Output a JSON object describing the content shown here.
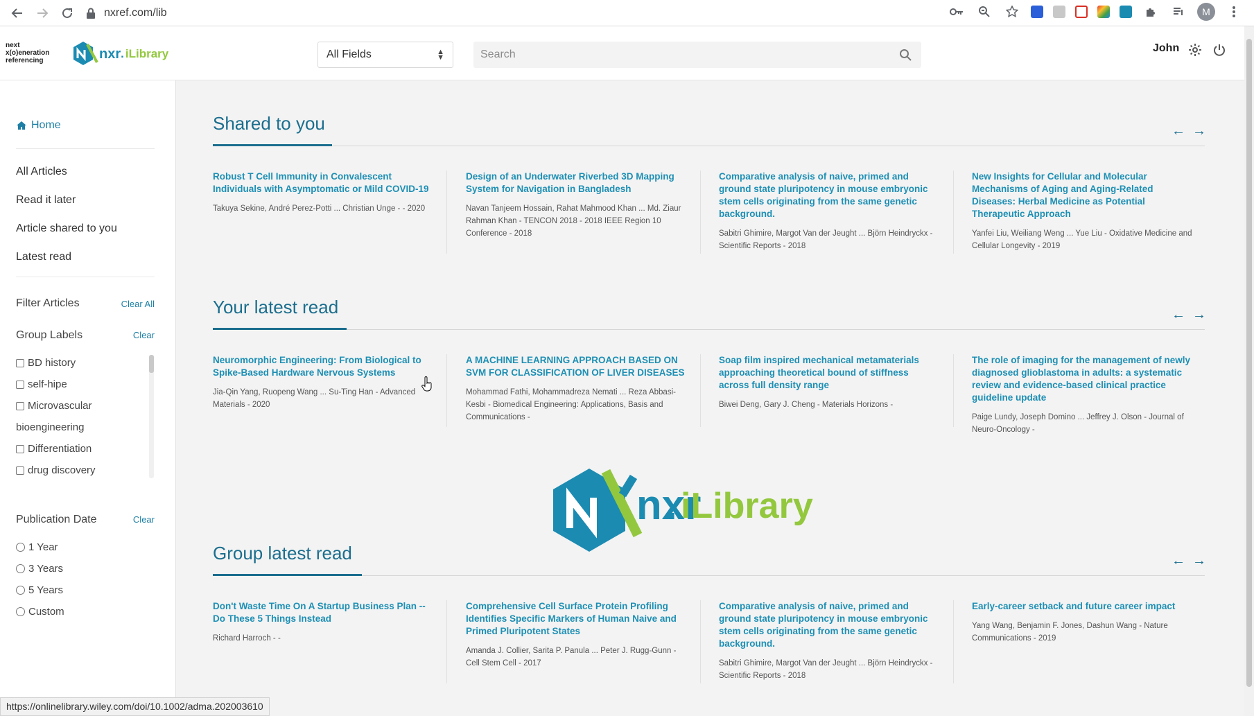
{
  "browser": {
    "url": "nxref.com/lib",
    "avatar_letter": "M",
    "status_url": "https://onlinelibrary.wiley.com/doi/10.1002/adma.202003610"
  },
  "header": {
    "brand_line1": "next",
    "brand_line2": "x(o)eneration",
    "brand_line3": "referencing",
    "logo_main": "nxr",
    "logo_dot": ".",
    "logo_sub": "iLibrary",
    "field_select": "All Fields",
    "search_placeholder": "Search",
    "user_name": "John"
  },
  "sidebar": {
    "home": "Home",
    "links": [
      "All Articles",
      "Read it later",
      "Article shared to you",
      "Latest read"
    ],
    "filter_title": "Filter Articles",
    "clear_all": "Clear All",
    "group_labels_title": "Group Labels",
    "group_labels_clear": "Clear",
    "group_labels": [
      "BD history",
      "self-hipe",
      "Microvascular",
      "bioengineering",
      "Differentiation",
      "drug discovery"
    ],
    "pub_date_title": "Publication Date",
    "pub_date_clear": "Clear",
    "pub_dates": [
      "1 Year",
      "3 Years",
      "5 Years",
      "Custom"
    ]
  },
  "sections": [
    {
      "title": "Shared to you",
      "cards": [
        {
          "title": "Robust T Cell Immunity in Convalescent Individuals with Asymptomatic or Mild COVID-19",
          "meta": "Takuya Sekine, André Perez-Potti ... Christian Unge - - 2020"
        },
        {
          "title": "Design of an Underwater Riverbed 3D Mapping System for Navigation in Bangladesh",
          "meta": "Navan Tanjeem Hossain, Rahat Mahmood Khan ... Md. Ziaur Rahman Khan - TENCON 2018 - 2018 IEEE Region 10 Conference - 2018"
        },
        {
          "title": "Comparative analysis of naive, primed and ground state pluripotency in mouse embryonic stem cells originating from the same genetic background.",
          "meta": "Sabitri Ghimire, Margot Van der Jeught ... Björn Heindryckx - Scientific Reports - 2018"
        },
        {
          "title": "New Insights for Cellular and Molecular Mechanisms of Aging and Aging-Related Diseases: Herbal Medicine as Potential Therapeutic Approach",
          "meta": "Yanfei Liu, Weiliang Weng ... Yue Liu - Oxidative Medicine and Cellular Longevity - 2019"
        }
      ]
    },
    {
      "title": "Your latest read",
      "cards": [
        {
          "title": "Neuromorphic Engineering: From Biological to Spike-Based Hardware Nervous Systems",
          "meta": "Jia-Qin Yang, Ruopeng Wang ... Su-Ting Han - Advanced Materials - 2020"
        },
        {
          "title": "A MACHINE LEARNING APPROACH BASED ON SVM FOR CLASSIFICATION OF LIVER DISEASES",
          "meta": "Mohammad Fathi, Mohammadreza Nemati ... Reza Abbasi-Kesbi - Biomedical Engineering: Applications, Basis and Communications -"
        },
        {
          "title": "Soap film inspired mechanical metamaterials approaching theoretical bound of stiffness across full density range",
          "meta": "Biwei Deng, Gary J. Cheng - Materials Horizons -"
        },
        {
          "title": "The role of imaging for the management of newly diagnosed glioblastoma in adults: a systematic review and evidence-based clinical practice guideline update",
          "meta": "Paige Lundy, Joseph Domino ... Jeffrey J. Olson - Journal of Neuro-Oncology -"
        }
      ]
    },
    {
      "title": "Group latest read",
      "cards": [
        {
          "title": "Don't Waste Time On A Startup Business Plan -- Do These 5 Things Instead",
          "meta": "Richard Harroch - -"
        },
        {
          "title": "Comprehensive Cell Surface Protein Profiling Identifies Specific Markers of Human Naive and Primed Pluripotent States",
          "meta": "Amanda J. Collier, Sarita P. Panula ... Peter J. Rugg-Gunn - Cell Stem Cell - 2017"
        },
        {
          "title": "Comparative analysis of naive, primed and ground state pluripotency in mouse embryonic stem cells originating from the same genetic background.",
          "meta": "Sabitri Ghimire, Margot Van der Jeught ... Björn Heindryckx - Scientific Reports - 2018"
        },
        {
          "title": "Early-career setback and future career impact",
          "meta": "Yang Wang, Benjamin F. Jones, Dashun Wang - Nature Communications - 2019"
        }
      ]
    }
  ],
  "watermark": {
    "main": "nxr",
    "dot": ".",
    "sub": "iLibrary"
  },
  "colors": {
    "accent": "#1b6e8e",
    "link": "#1d8fb4",
    "logo_blue": "#1b8bb2",
    "logo_green": "#93c83e"
  }
}
